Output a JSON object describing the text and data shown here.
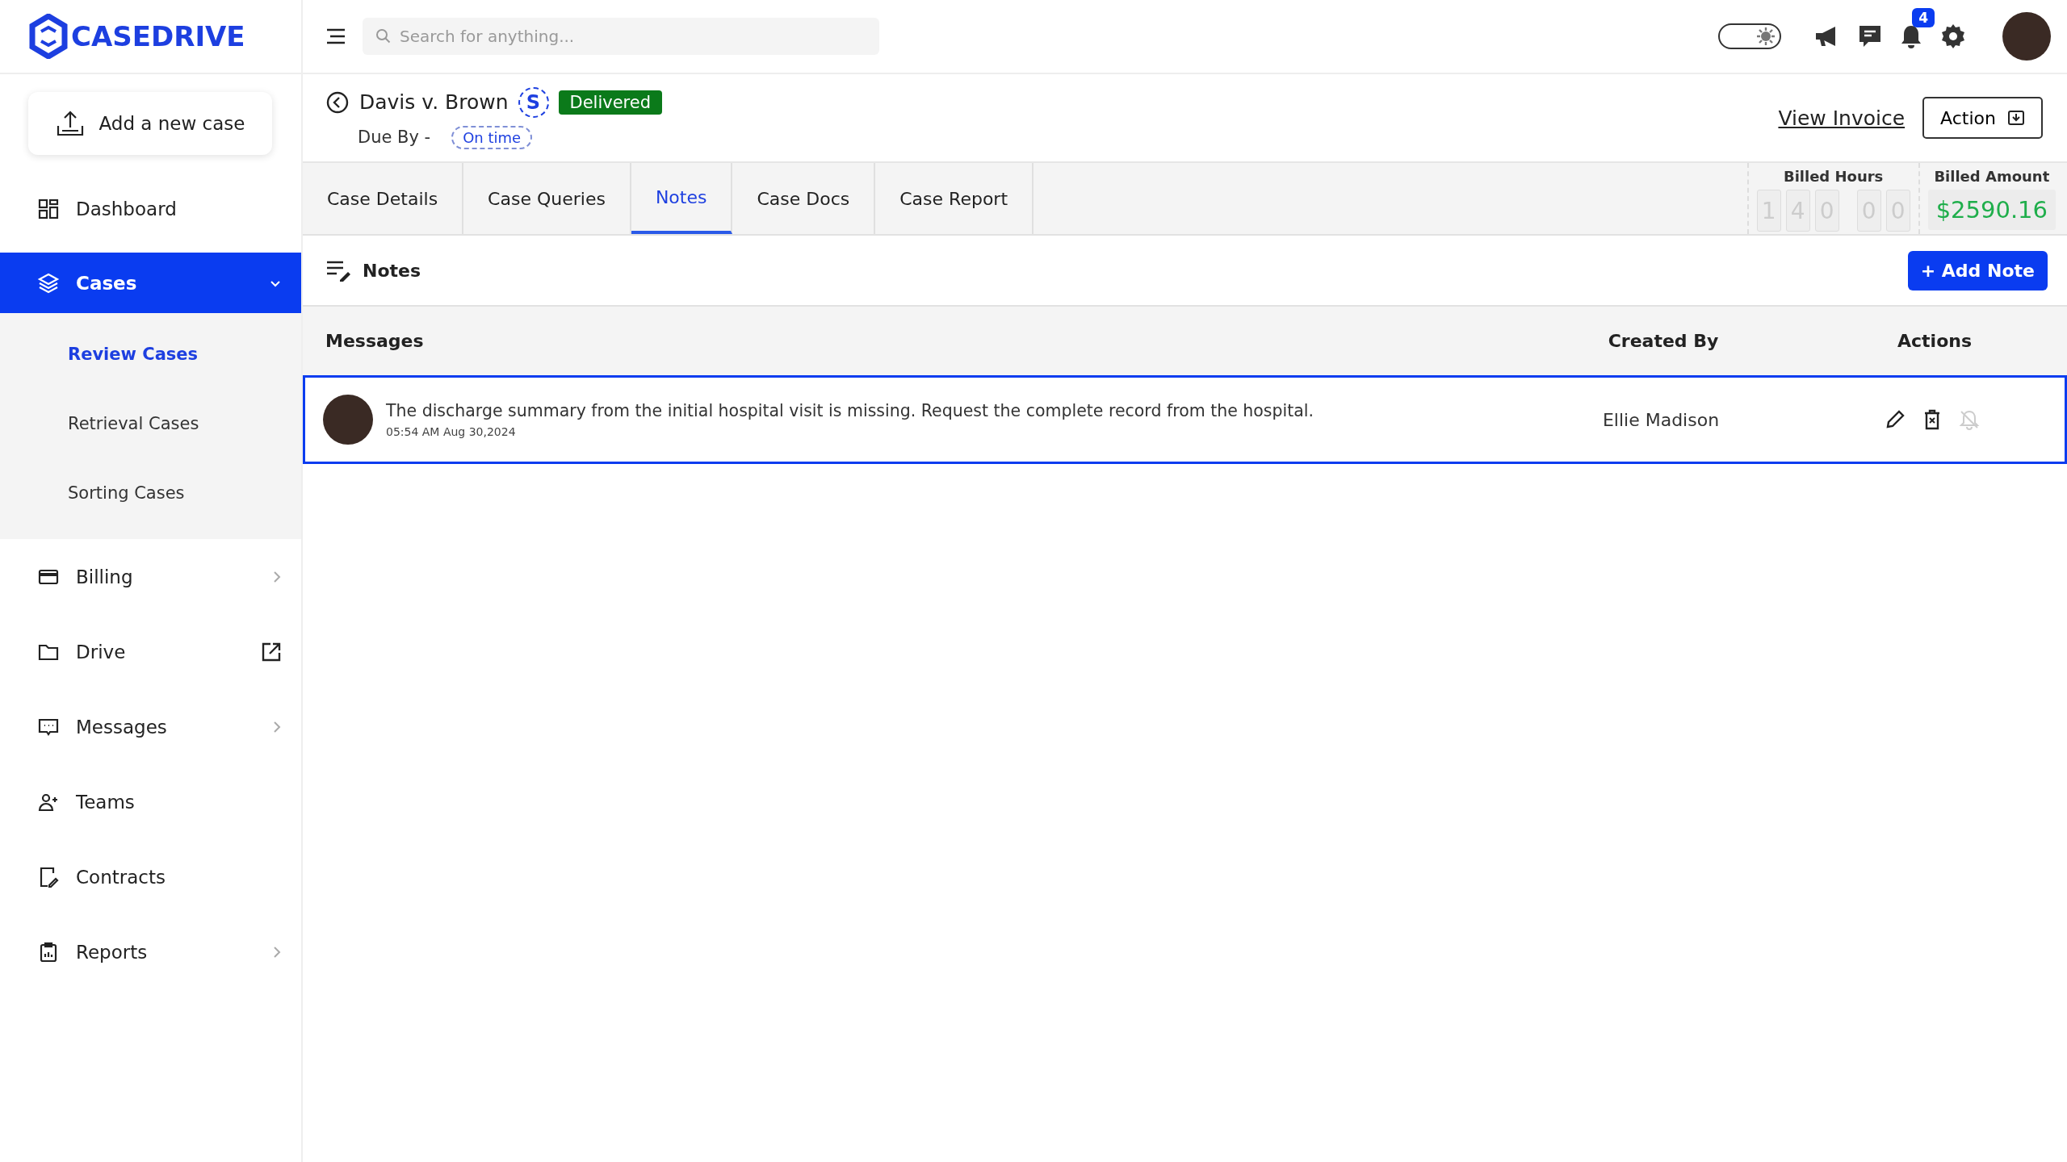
{
  "brand": {
    "name": "CASEDRIVE"
  },
  "topbar": {
    "search": {
      "placeholder": "Search for anything..."
    },
    "theme_toggle": {
      "on": true
    },
    "notifications": {
      "badge": "4"
    }
  },
  "sidebar": {
    "add_button": "Add a new case",
    "items": [
      {
        "label": "Dashboard",
        "selected": false,
        "kind": "plain"
      },
      {
        "label": "Cases",
        "selected": true,
        "kind": "expandable",
        "expanded": true,
        "children": [
          {
            "label": "Review Cases",
            "selected": true
          },
          {
            "label": "Retrieval Cases",
            "selected": false
          },
          {
            "label": "Sorting Cases",
            "selected": false
          }
        ]
      },
      {
        "label": "Billing",
        "selected": false,
        "kind": "submenu"
      },
      {
        "label": "Drive",
        "selected": false,
        "kind": "external"
      },
      {
        "label": "Messages",
        "selected": false,
        "kind": "submenu"
      },
      {
        "label": "Teams",
        "selected": false,
        "kind": "plain"
      },
      {
        "label": "Contracts",
        "selected": false,
        "kind": "plain"
      },
      {
        "label": "Reports",
        "selected": false,
        "kind": "submenu"
      }
    ]
  },
  "case": {
    "title": "Davis v. Brown",
    "initial": "S",
    "status": "Delivered",
    "due_label": "Due By -",
    "due_status": "On time",
    "view_invoice": "View Invoice",
    "action": "Action"
  },
  "tabs": [
    {
      "label": "Case Details",
      "selected": false
    },
    {
      "label": "Case Queries",
      "selected": false
    },
    {
      "label": "Notes",
      "selected": true
    },
    {
      "label": "Case Docs",
      "selected": false
    },
    {
      "label": "Case Report",
      "selected": false
    }
  ],
  "billing": {
    "hours_label": "Billed Hours",
    "hour_digits": [
      "1",
      "4",
      "0"
    ],
    "minute_digits": [
      "0",
      "0"
    ],
    "amount_label": "Billed Amount",
    "amount": "$2590.16"
  },
  "notes": {
    "title": "Notes",
    "add_button": "+ Add Note",
    "columns": [
      "Messages",
      "Created By",
      "Actions"
    ],
    "rows": [
      {
        "message": "The discharge summary from the initial hospital visit is missing. Request the complete record from the hospital.",
        "time": "05:54 AM Aug 30,2024",
        "created_by": "Ellie Madison",
        "selected": true,
        "reminder_on": false
      }
    ]
  }
}
